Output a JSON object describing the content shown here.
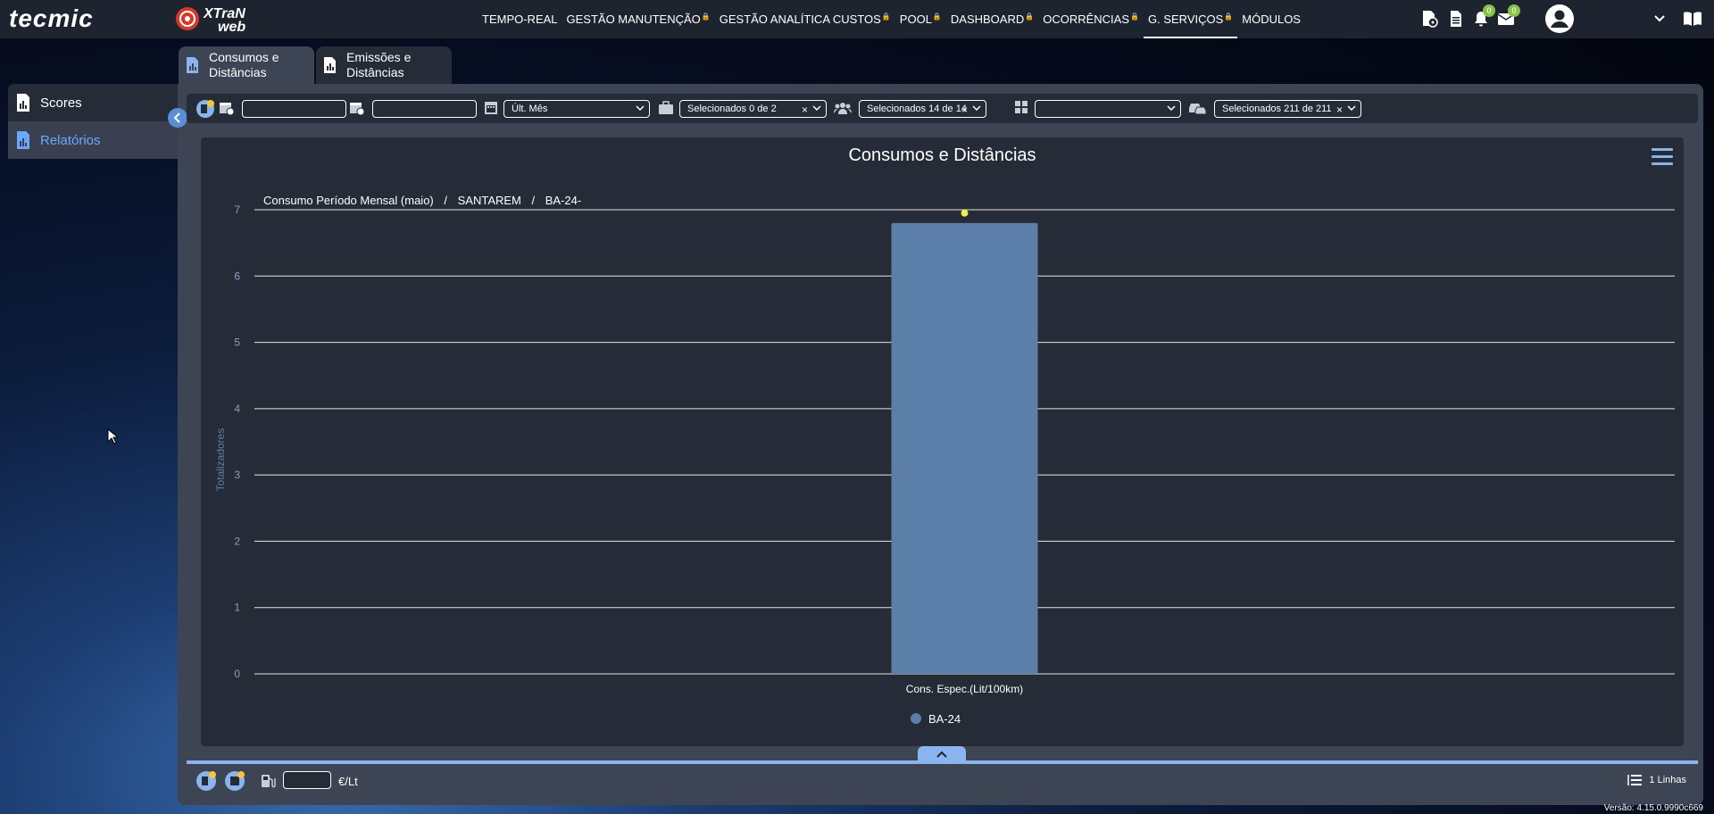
{
  "nav": {
    "items": [
      {
        "label": "TEMPO-REAL",
        "locked": false
      },
      {
        "label": "GESTÃO MANUTENÇÃO",
        "locked": true
      },
      {
        "label": "GESTÃO ANALÍTICA CUSTOS",
        "locked": true
      },
      {
        "label": "POOL",
        "locked": true
      },
      {
        "label": "DASHBOARD",
        "locked": true
      },
      {
        "label": "OCORRÊNCIAS",
        "locked": true
      },
      {
        "label": "G. SERVIÇOS",
        "locked": true
      },
      {
        "label": "MÓDULOS",
        "locked": false
      }
    ],
    "active": "G. SERVIÇOS",
    "notifications_count": "0",
    "messages_count": "0"
  },
  "sidebar": {
    "items": [
      {
        "label": "Scores",
        "icon": "report-icon"
      },
      {
        "label": "Relatórios",
        "icon": "report-icon"
      }
    ],
    "active": "Relatórios"
  },
  "tabs": [
    {
      "line1": "Consumos e",
      "line2": "Distâncias"
    },
    {
      "line1": "Emissões e",
      "line2": "Distâncias"
    }
  ],
  "filters": {
    "date_from": "",
    "date_to": "",
    "period": "Últ. Mês",
    "companies": "Selecionados 0 de 2",
    "groups": "Selecionados 14 de 14",
    "category": "",
    "vehicles": "Selecionados 211 de 211"
  },
  "breadcrumb": [
    "Consumo Período Mensal (maio)",
    "/",
    "SANTAREM",
    "/",
    "BA-24-"
  ],
  "chart_data": {
    "type": "bar",
    "title": "Consumos e Distâncias",
    "categories": [
      "Cons. Espec.(Lit/100km)"
    ],
    "series": [
      {
        "name": "BA-24",
        "values": [
          6.8
        ],
        "color": "#5b7fa8"
      }
    ],
    "marker_value": 6.95,
    "marker_color": "#e8f04a",
    "ylabel": "Totalizadores",
    "xlabel": "",
    "ylim": [
      0,
      7
    ],
    "yticks": [
      0,
      1,
      2,
      3,
      4,
      5,
      6,
      7
    ],
    "grid": true,
    "legend": "bottom-center"
  },
  "footer": {
    "fuel_price": "",
    "unit": "€/Lt",
    "lines_label": "1 Linhas",
    "version": "Versão: 4.15.0.9990c669"
  },
  "colors": {
    "accent": "#8ab4ee",
    "panel": "#262b38",
    "active_link": "#6aa8ff",
    "badge": "#8bc34a"
  }
}
